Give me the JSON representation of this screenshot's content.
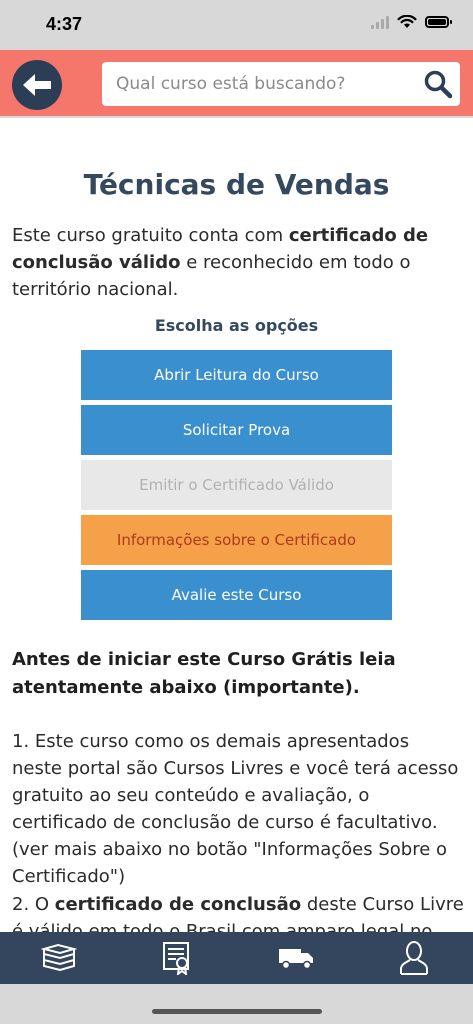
{
  "status_bar": {
    "time": "4:37"
  },
  "header": {
    "back_icon": "arrow-left-icon",
    "search_placeholder": "Qual curso está buscando?",
    "search_icon": "magnifier-icon",
    "bg_color": "#f5766b",
    "accent_color": "#2c3e55"
  },
  "course": {
    "title": "Técnicas de Vendas",
    "intro_prefix": "Este curso gratuito conta com ",
    "intro_bold": "certificado de conclusão válido",
    "intro_suffix": " e reconhecido em todo o território nacional."
  },
  "options": {
    "heading": "Escolha as opções",
    "buttons": [
      {
        "label": "Abrir Leitura do Curso",
        "style": "blue"
      },
      {
        "label": "Solicitar Prova",
        "style": "blue"
      },
      {
        "label": "Emitir o Certificado Válido",
        "style": "disabled"
      },
      {
        "label": "Informações sobre o Certificado",
        "style": "orange"
      },
      {
        "label": "Avalie este Curso",
        "style": "blue"
      }
    ]
  },
  "notice": {
    "heading": "Antes de iniciar este Curso Grátis leia atentamente abaixo (importante).",
    "paragraph1": "1. Este curso como os demais apresentados neste portal são Cursos Livres e você terá acesso gratuito ao seu conteúdo e avaliação, o certificado de conclusão de curso é facultativo. (ver mais abaixo no botão \"Informações Sobre o Certificado\")",
    "paragraph2_prefix": "2. O ",
    "paragraph2_bold": "certificado de conclusão",
    "paragraph2_suffix": " deste Curso Livre é válido em todo o Brasil com amparo legal no"
  },
  "bottom_nav": {
    "items": [
      {
        "icon": "books-icon"
      },
      {
        "icon": "certificate-icon"
      },
      {
        "icon": "delivery-truck-icon"
      },
      {
        "icon": "user-icon"
      }
    ],
    "bg_color": "#34455e"
  }
}
